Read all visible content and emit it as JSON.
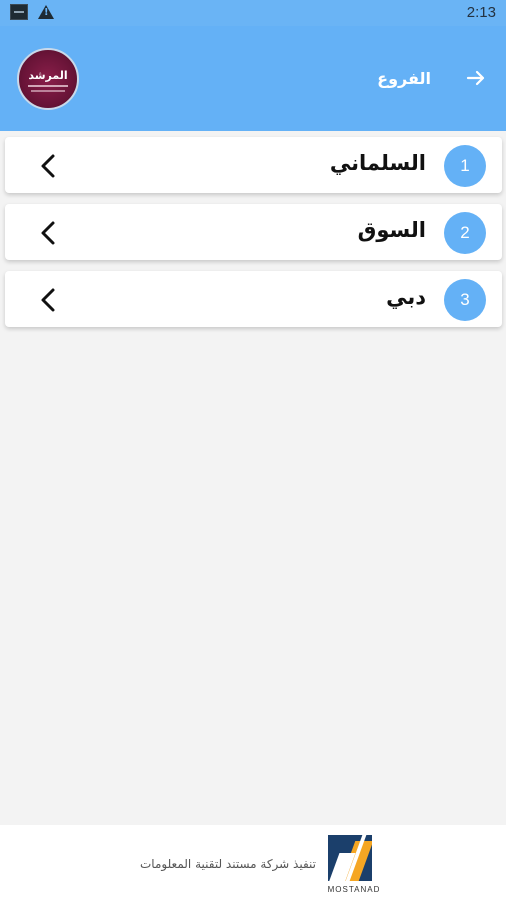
{
  "status_bar": {
    "time": "2:13",
    "icons": [
      "screenshot-thumbnail-icon",
      "warning-icon"
    ]
  },
  "app_bar": {
    "title": "الفروع",
    "logo_text": "المرشد",
    "back_icon": "arrow-right-icon",
    "background": "#64b1f6"
  },
  "branches": [
    {
      "number": "1",
      "name": "السلماني"
    },
    {
      "number": "2",
      "name": "السوق"
    },
    {
      "number": "3",
      "name": "دبي"
    }
  ],
  "footer": {
    "text": "تنفيذ شركة مستند لتقنية المعلومات",
    "brand": "MOSTANAD"
  },
  "colors": {
    "accent": "#64b1f6",
    "background": "#f3f3f3"
  }
}
